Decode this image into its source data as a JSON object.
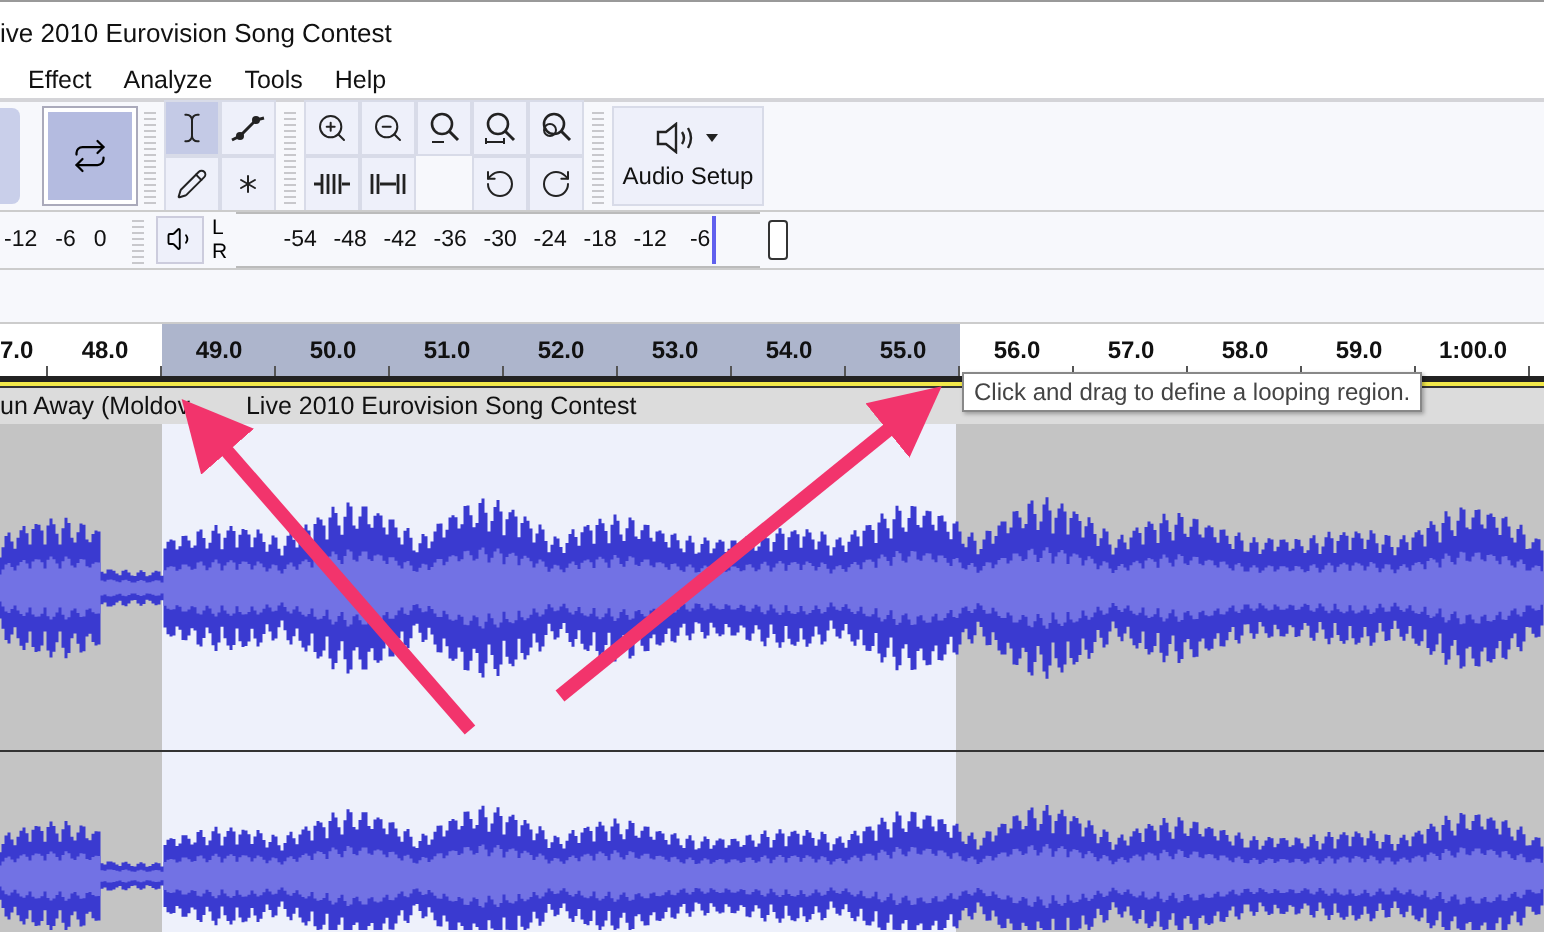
{
  "window": {
    "title": "ive 2010 Eurovision Song Contest"
  },
  "menu": [
    {
      "label": "Effect"
    },
    {
      "label": "Analyze"
    },
    {
      "label": "Tools"
    },
    {
      "label": "Help"
    }
  ],
  "toolbar": {
    "loop_button": {
      "selected": true
    },
    "tools": [
      {
        "kind": "select",
        "selected": true
      },
      {
        "kind": "envelope",
        "selected": false
      },
      {
        "kind": "draw",
        "selected": false
      },
      {
        "kind": "multi",
        "selected": false
      }
    ],
    "zoom": [
      {
        "kind": "zoom-in"
      },
      {
        "kind": "zoom-out"
      },
      {
        "kind": "fit-selection"
      },
      {
        "kind": "fit-project"
      },
      {
        "kind": "zoom-toggle"
      },
      {
        "kind": "trim"
      },
      {
        "kind": "silence"
      },
      {
        "kind": "blank"
      },
      {
        "kind": "undo"
      },
      {
        "kind": "redo"
      }
    ],
    "audio_setup": {
      "label": "Audio Setup"
    }
  },
  "recording_meter": {
    "scale": [
      "-12",
      "-6",
      "0"
    ]
  },
  "playback_meter": {
    "channels": [
      "L",
      "R"
    ],
    "scale": [
      "-54",
      "-48",
      "-42",
      "-36",
      "-30",
      "-24",
      "-18",
      "-12",
      "-6"
    ],
    "level": 0.91
  },
  "ruler": {
    "labels": [
      {
        "text": "7.0",
        "in_loop": false
      },
      {
        "text": "48.0",
        "in_loop": false
      },
      {
        "text": "49.0",
        "in_loop": true
      },
      {
        "text": "50.0",
        "in_loop": true
      },
      {
        "text": "51.0",
        "in_loop": true
      },
      {
        "text": "52.0",
        "in_loop": true
      },
      {
        "text": "53.0",
        "in_loop": true
      },
      {
        "text": "54.0",
        "in_loop": true
      },
      {
        "text": "55.0",
        "in_loop": true
      },
      {
        "text": "56.0",
        "in_loop": false
      },
      {
        "text": "57.0",
        "in_loop": false
      },
      {
        "text": "58.0",
        "in_loop": false
      },
      {
        "text": "59.0",
        "in_loop": false
      },
      {
        "text": "1:00.0",
        "in_loop": false
      }
    ]
  },
  "track": {
    "name_parts": [
      "un Away (Moldov",
      "Live 2010 Eurovision Song Contest"
    ]
  },
  "tooltip": {
    "text": "Click and drag to define a looping region."
  }
}
